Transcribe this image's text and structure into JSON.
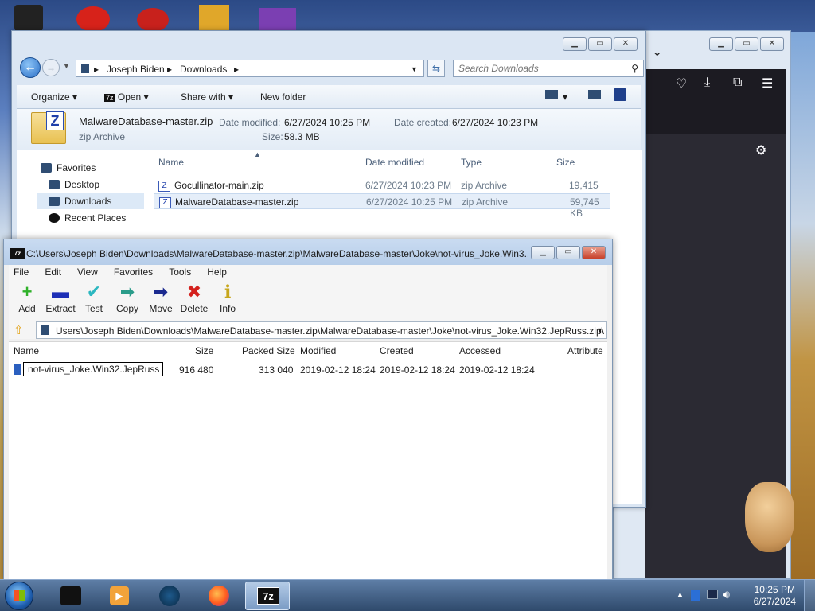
{
  "desktop": {
    "icons": [
      "recycle-bin",
      "app-red",
      "app-red-2",
      "app-gold",
      "visual-studio"
    ]
  },
  "firefox": {
    "icons": [
      "pocket-icon",
      "download-icon",
      "extensions-icon",
      "menu-icon",
      "settings-icon"
    ]
  },
  "explorer": {
    "breadcrumb": [
      "Joseph Biden",
      "Downloads"
    ],
    "search_placeholder": "Search Downloads",
    "commands": {
      "organize": "Organize",
      "open": "Open",
      "share": "Share with",
      "new_folder": "New folder"
    },
    "details": {
      "filename": "MalwareDatabase-master.zip",
      "type": "zip Archive",
      "date_modified_label": "Date modified:",
      "date_modified": "6/27/2024 10:25 PM",
      "date_created_label": "Date created:",
      "date_created": "6/27/2024 10:23 PM",
      "size_label": "Size:",
      "size": "58.3 MB"
    },
    "nav": {
      "favorites": "Favorites",
      "desktop": "Desktop",
      "downloads": "Downloads",
      "recent": "Recent Places"
    },
    "columns": {
      "name": "Name",
      "date": "Date modified",
      "type": "Type",
      "size": "Size"
    },
    "files": [
      {
        "name": "Gocullinator-main.zip",
        "date": "6/27/2024 10:23 PM",
        "type": "zip Archive",
        "size": "19,415 KB"
      },
      {
        "name": "MalwareDatabase-master.zip",
        "date": "6/27/2024 10:25 PM",
        "type": "zip Archive",
        "size": "59,745 KB"
      }
    ]
  },
  "sevenzip": {
    "title": "C:\\Users\\Joseph Biden\\Downloads\\MalwareDatabase-master.zip\\MalwareDatabase-master\\Joke\\not-virus_Joke.Win3...",
    "logo": "7z",
    "menu": [
      "File",
      "Edit",
      "View",
      "Favorites",
      "Tools",
      "Help"
    ],
    "tools": [
      {
        "label": "Add",
        "icon": "+",
        "color": "#2fb12a"
      },
      {
        "label": "Extract",
        "icon": "▬",
        "color": "#1d2fb6"
      },
      {
        "label": "Test",
        "icon": "✔",
        "color": "#2bb7c0"
      },
      {
        "label": "Copy",
        "icon": "➡",
        "color": "#2a9c8a"
      },
      {
        "label": "Move",
        "icon": "➡",
        "color": "#1b2a8f"
      },
      {
        "label": "Delete",
        "icon": "✖",
        "color": "#d4211d"
      },
      {
        "label": "Info",
        "icon": "ℹ",
        "color": "#c7a61b"
      }
    ],
    "path": "Users\\Joseph Biden\\Downloads\\MalwareDatabase-master.zip\\MalwareDatabase-master\\Joke\\not-virus_Joke.Win32.JepRuss.zip\\",
    "columns": {
      "name": "Name",
      "size": "Size",
      "packed": "Packed Size",
      "modified": "Modified",
      "created": "Created",
      "accessed": "Accessed",
      "attr": "Attribute"
    },
    "row": {
      "name": "not-virus_Joke.Win32.JepRuss",
      "size": "916 480",
      "packed": "313 040",
      "modified": "2019-02-12 18:24",
      "created": "2019-02-12 18:24",
      "accessed": "2019-02-12 18:24"
    }
  },
  "taskbar": {
    "apps": [
      "explorer",
      "media-player",
      "globe-app",
      "firefox",
      "7-zip"
    ],
    "seven_zip_label": "7z",
    "time": "10:25 PM",
    "date": "6/27/2024"
  }
}
